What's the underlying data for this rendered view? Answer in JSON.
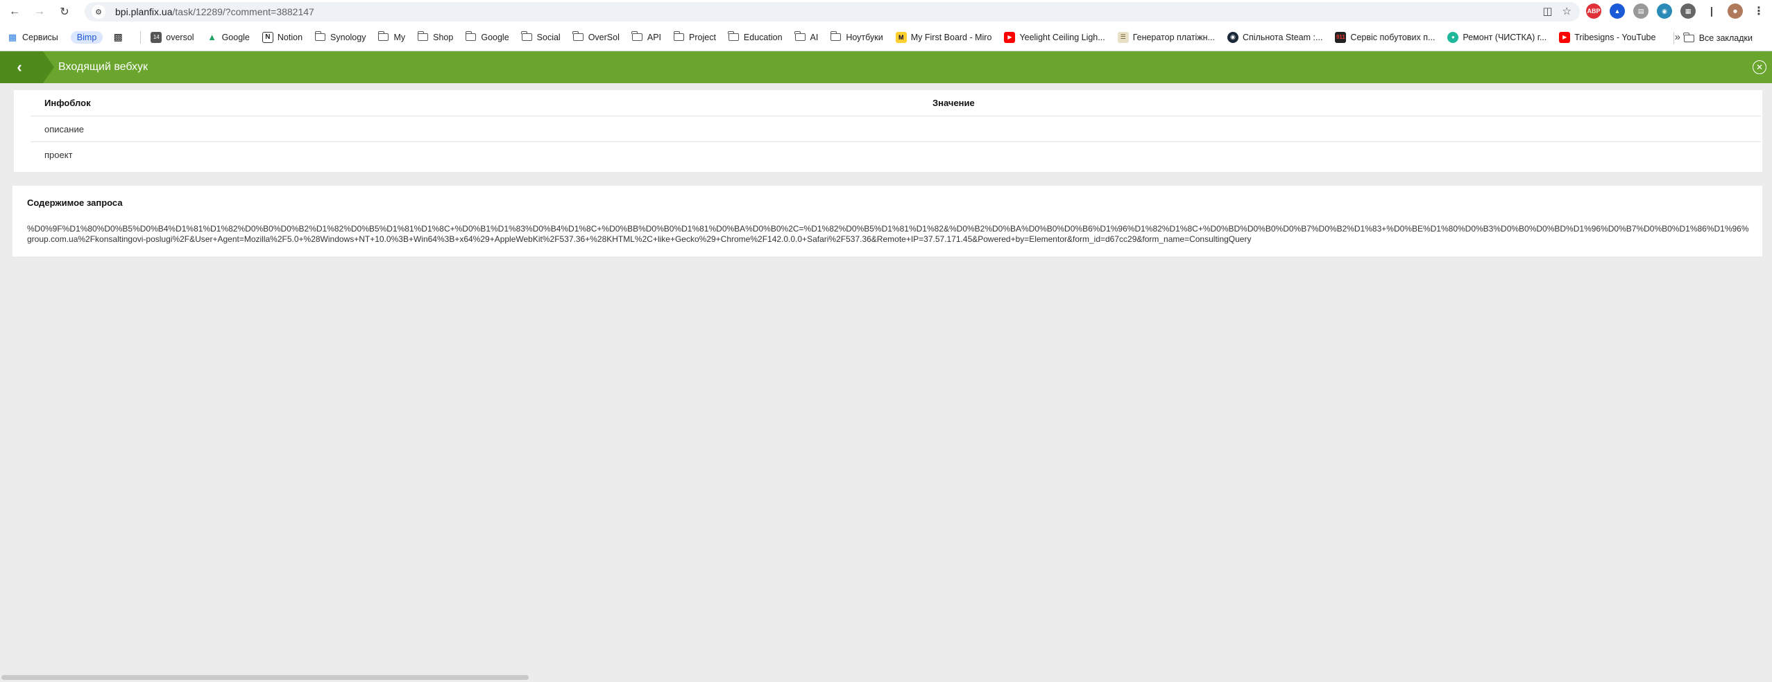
{
  "browser": {
    "url_host": "bpi.planfix.ua",
    "url_path": "/task/12289/?comment=3882147"
  },
  "bookmarks": [
    {
      "label": "Сервисы",
      "icon": "apps-grid-icon"
    },
    {
      "label": "Bimp",
      "icon": "pill"
    },
    {
      "label": "",
      "icon": "qr-icon"
    },
    {
      "label": "oversol",
      "icon": "calendar-icon"
    },
    {
      "label": "Google",
      "icon": "google-drive-icon"
    },
    {
      "label": "Notion",
      "icon": "notion-icon"
    },
    {
      "label": "Synology",
      "icon": "folder-icon"
    },
    {
      "label": "My",
      "icon": "folder-icon"
    },
    {
      "label": "Shop",
      "icon": "folder-icon"
    },
    {
      "label": "Google",
      "icon": "folder-icon"
    },
    {
      "label": "Social",
      "icon": "folder-icon"
    },
    {
      "label": "OverSol",
      "icon": "folder-icon"
    },
    {
      "label": "API",
      "icon": "folder-icon"
    },
    {
      "label": "Project",
      "icon": "folder-icon"
    },
    {
      "label": "Education",
      "icon": "folder-icon"
    },
    {
      "label": "AI",
      "icon": "folder-icon"
    },
    {
      "label": "Ноутбуки",
      "icon": "folder-icon"
    },
    {
      "label": "My First Board - Miro",
      "icon": "miro-icon"
    },
    {
      "label": "Yeelight Ceiling Ligh...",
      "icon": "youtube-icon"
    },
    {
      "label": "Генератор платіжн...",
      "icon": "document-icon"
    },
    {
      "label": "Спільнота Steam :...",
      "icon": "steam-icon"
    },
    {
      "label": "Сервіс побутових п...",
      "icon": "service-icon"
    },
    {
      "label": "Ремонт (ЧИСТКА) г...",
      "icon": "repair-icon"
    },
    {
      "label": "Tribesigns - YouTube",
      "icon": "youtube-icon"
    }
  ],
  "bookmarks_all": "Все закладки",
  "page": {
    "title": "Входящий вебхук"
  },
  "table": {
    "headers": [
      "Инфоблок",
      "Значение"
    ],
    "rows": [
      [
        "описание",
        ""
      ],
      [
        "проект",
        ""
      ]
    ]
  },
  "request": {
    "title": "Содержимое запроса",
    "line1": "%D0%9F%D1%80%D0%B5%D0%B4%D1%81%D1%82%D0%B0%D0%B2%D1%82%D0%B5%D1%81%D1%8C+%D0%B1%D1%83%D0%B4%D1%8C+%D0%BB%D0%B0%D1%81%D0%BA%D0%B0%2C=%D1%82%D0%B5%D1%81%D1%82&%D0%B2%D0%BA%D0%B0%D0%B6%D1%96%D1%82%D1%8C+%D0%BD%D0%B0%D0%B7%D0%B2%D1%83+%D0%BE%D1%80%D0%B3%D0%B0%D0%BD%D1%96%D0%B7%D0%B0%D1%86%D1%96%",
    "line2": "group.com.ua%2Fkonsaltingovi-poslugi%2F&User+Agent=Mozilla%2F5.0+%28Windows+NT+10.0%3B+Win64%3B+x64%29+AppleWebKit%2F537.36+%28KHTML%2C+like+Gecko%29+Chrome%2F142.0.0.0+Safari%2F537.36&Remote+IP=37.57.171.45&Powered+by=Elementor&form_id=d67cc29&form_name=ConsultingQuery"
  },
  "colors": {
    "header_green": "#6aa62e",
    "back_green": "#4e8a1c",
    "page_bg": "#ececec"
  }
}
